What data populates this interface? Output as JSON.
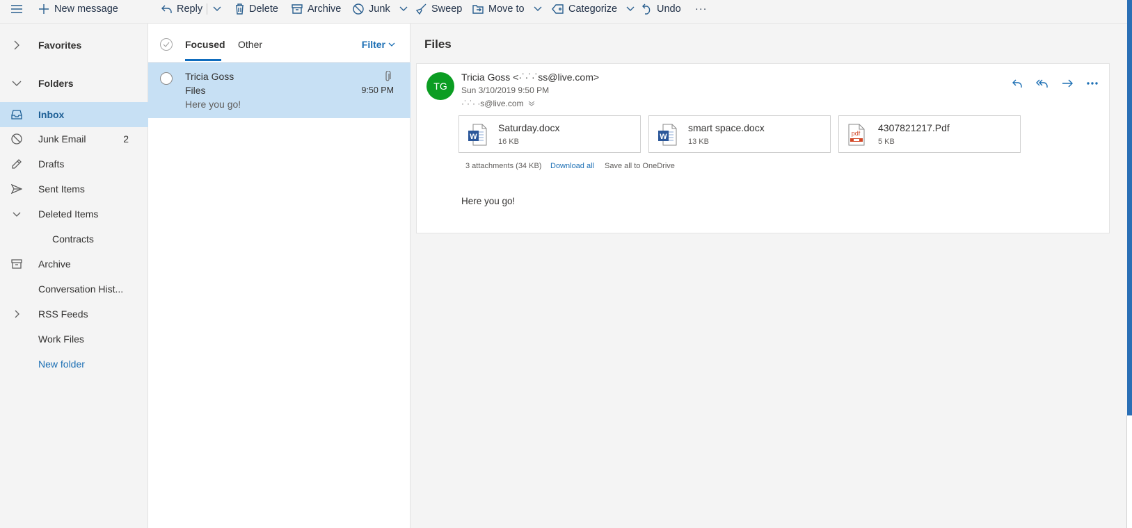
{
  "toolbar": {
    "new_message": "New message",
    "reply": "Reply",
    "delete": "Delete",
    "archive": "Archive",
    "junk": "Junk",
    "sweep": "Sweep",
    "move_to": "Move to",
    "categorize": "Categorize",
    "undo": "Undo",
    "more": "···"
  },
  "nav": {
    "favorites": "Favorites",
    "folders": "Folders",
    "items": [
      {
        "label": "Inbox",
        "icon": "inbox-icon"
      },
      {
        "label": "Junk Email",
        "icon": "block-icon",
        "count": "2"
      },
      {
        "label": "Drafts",
        "icon": "pencil-icon"
      },
      {
        "label": "Sent Items",
        "icon": "send-icon"
      },
      {
        "label": "Deleted Items",
        "icon": "chevron-down-icon"
      },
      {
        "label": "Contracts"
      },
      {
        "label": "Archive",
        "icon": "archive-icon"
      },
      {
        "label": "Conversation Hist..."
      },
      {
        "label": "RSS Feeds",
        "icon": "chevron-right-icon"
      },
      {
        "label": "Work Files"
      }
    ],
    "new_folder": "New folder"
  },
  "list": {
    "tab_focused": "Focused",
    "tab_other": "Other",
    "filter": "Filter",
    "message": {
      "from": "Tricia Goss",
      "subject": "Files",
      "preview": "Here you go!",
      "time": "9:50 PM"
    }
  },
  "reading": {
    "subject": "Files",
    "avatar_initials": "TG",
    "avatar_color": "#0b9d22",
    "sender": "Tricia Goss <·˙·˙·˙ss@live.com>",
    "date": "Sun 3/10/2019 9:50 PM",
    "to": "·˙·˙· ·s@live.com",
    "attachments": [
      {
        "name": "Saturday.docx",
        "size": "16 KB",
        "type": "word"
      },
      {
        "name": "smart space.docx",
        "size": "13 KB",
        "type": "word"
      },
      {
        "name": "4307821217.Pdf",
        "size": "5 KB",
        "type": "pdf"
      }
    ],
    "attachment_summary": "3 attachments (34 KB)",
    "download_all": "Download all",
    "save_onedrive": "Save all to OneDrive",
    "body": "Here you go!"
  },
  "colors": {
    "accent": "#0f6cbd",
    "selection": "#c7e0f4",
    "word_blue": "#2b579a",
    "pdf_red": "#d24726"
  }
}
